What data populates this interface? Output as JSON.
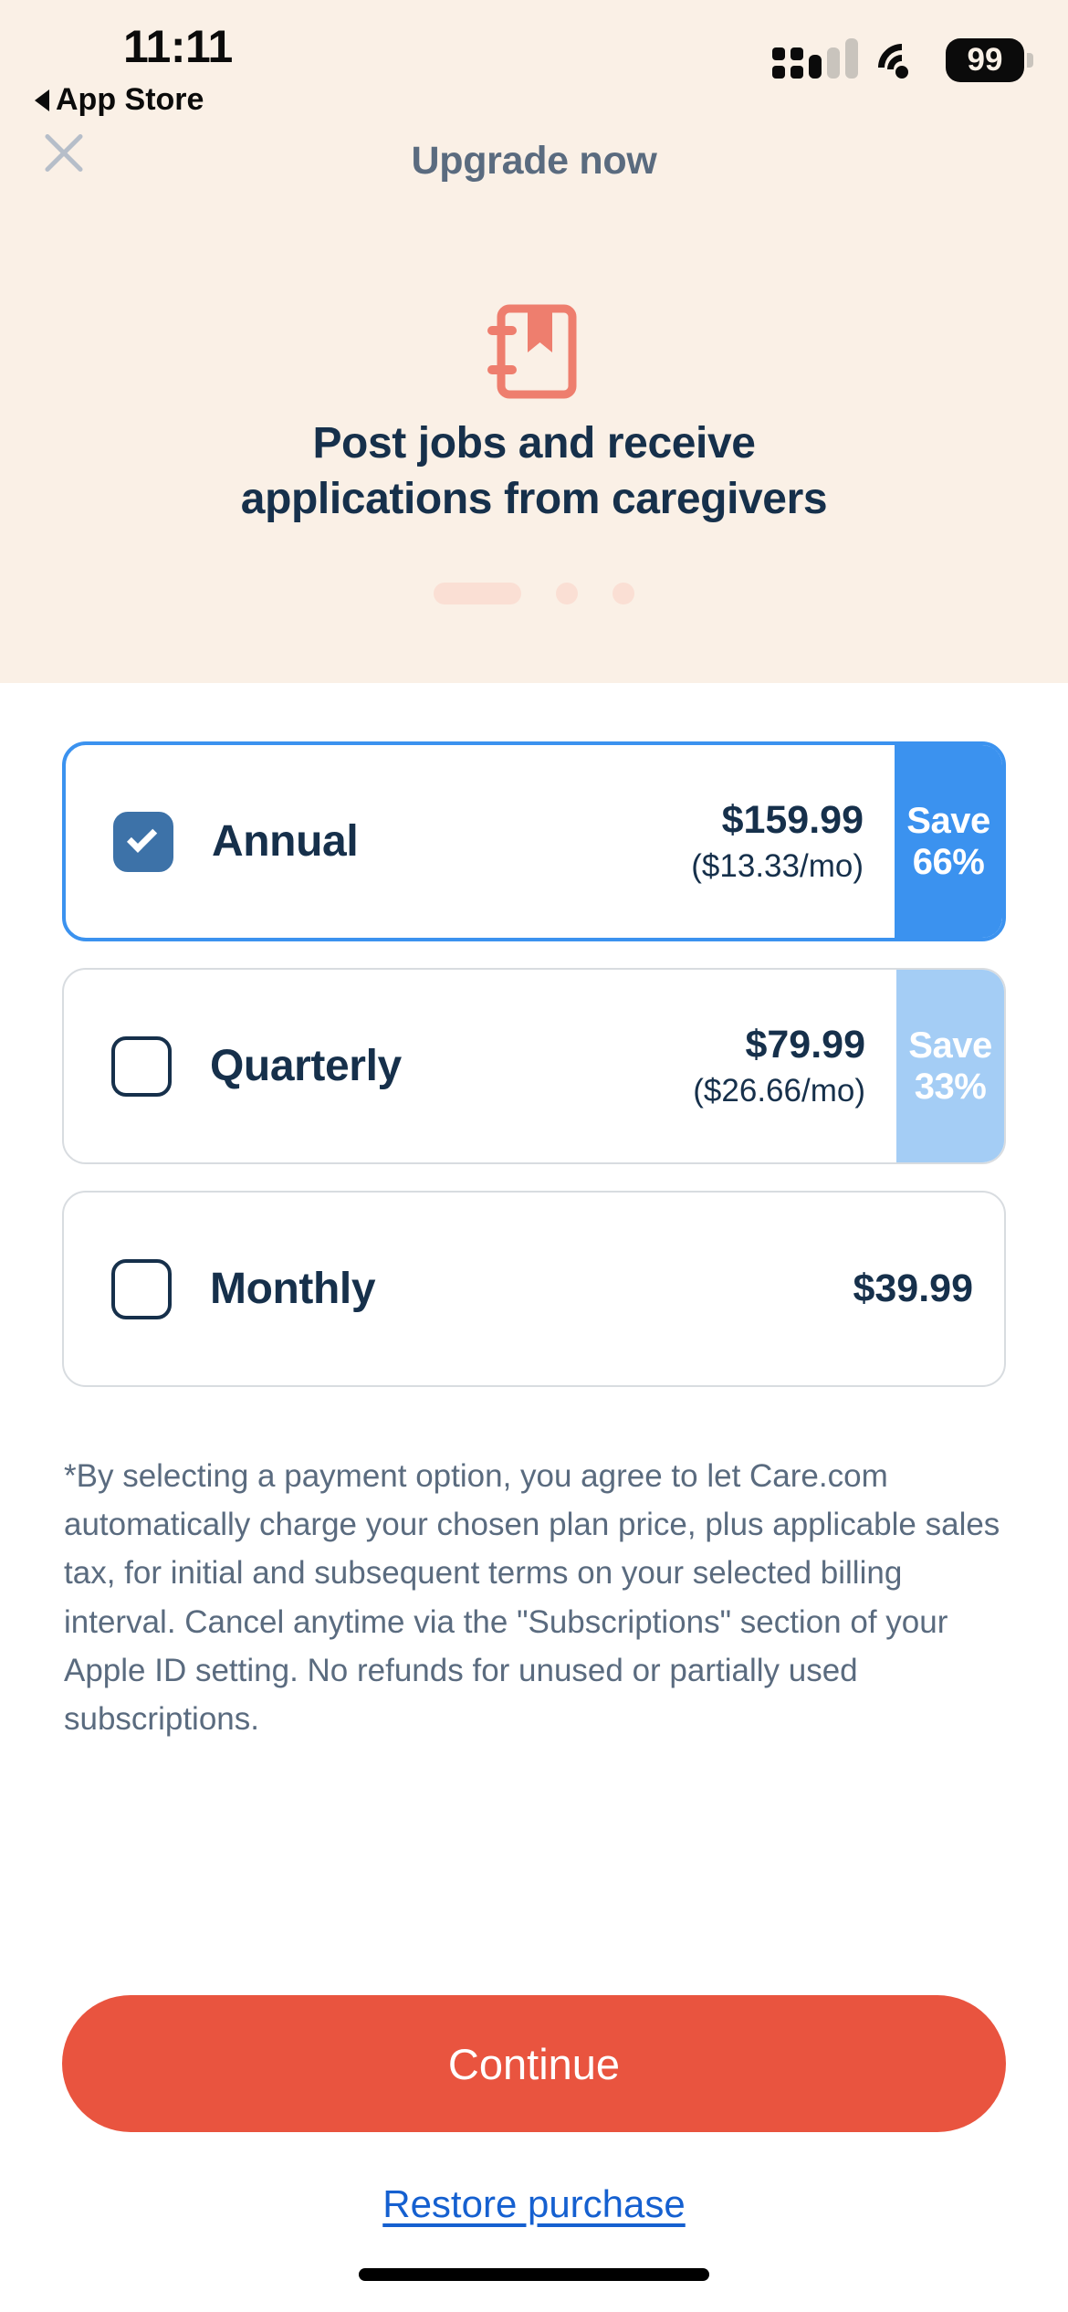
{
  "status_bar": {
    "time": "11:11",
    "back_label": "App Store",
    "back_icon": "triangle-left-icon",
    "cellular_icon": "cellular-signal-icon",
    "wifi_icon": "wifi-icon",
    "battery_level": "99",
    "battery_icon": "battery-icon"
  },
  "header": {
    "close_icon": "close-icon",
    "title": "Upgrade now"
  },
  "hero": {
    "icon": "notebook-bookmark-icon",
    "headline_line1": "Post jobs and receive",
    "headline_line2": "applications from caregivers",
    "pagination": {
      "total": 3,
      "active_index": 0
    },
    "background_color": "#FAF0E6",
    "icon_color": "#EE7E6E",
    "dot_color": "#FADFD4"
  },
  "plans": [
    {
      "id": "annual",
      "name": "Annual",
      "price": "$159.99",
      "per_month": "($13.33/mo)",
      "save_line1": "Save",
      "save_line2": "66%",
      "selected": true,
      "badge_color": "#3B92EF"
    },
    {
      "id": "quarterly",
      "name": "Quarterly",
      "price": "$79.99",
      "per_month": "($26.66/mo)",
      "save_line1": "Save",
      "save_line2": "33%",
      "selected": false,
      "badge_color": "#A4CDF5"
    },
    {
      "id": "monthly",
      "name": "Monthly",
      "price": "$39.99",
      "per_month": "",
      "save_line1": "",
      "save_line2": "",
      "selected": false,
      "badge_color": ""
    }
  ],
  "disclaimer": "*By selecting a payment option, you agree to let Care.com automatically charge your chosen plan price, plus applicable sales tax, for initial and subsequent terms on your selected billing interval. Cancel anytime via the \"Subscriptions\" section of your Apple ID setting. No refunds for unused or partially used subscriptions.",
  "footer": {
    "cta_label": "Continue",
    "cta_color": "#E9543F",
    "restore_label": "Restore purchase",
    "restore_color": "#1560D0"
  },
  "theme": {
    "text_dark": "#16304B",
    "text_muted": "#5A6B7F",
    "selected_border": "#3B92EF",
    "checkbox_checked": "#3D72A8"
  }
}
